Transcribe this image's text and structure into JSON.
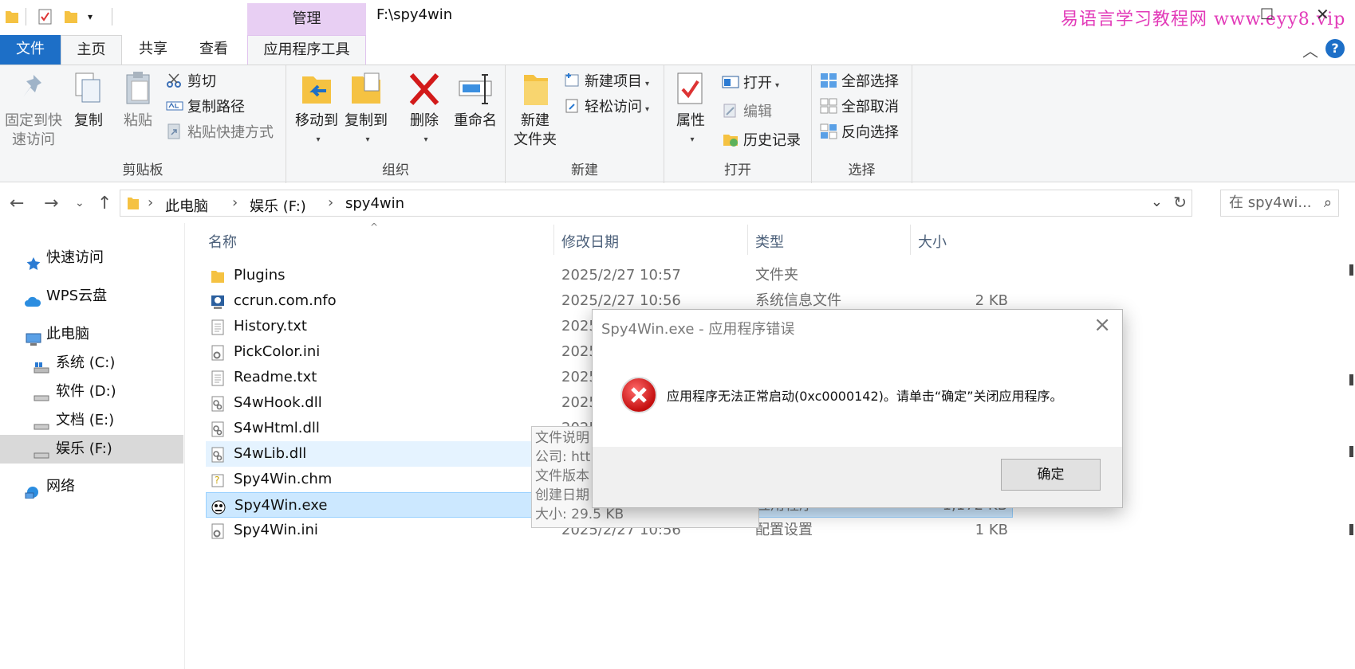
{
  "titlebar": {
    "manage_tab": "管理",
    "path": "F:\\spy4win",
    "watermark": "易语言学习教程网 www.eyy8.vip",
    "maximize": "□",
    "close": "✕"
  },
  "tabs": {
    "file": "文件",
    "home": "主页",
    "share": "共享",
    "view": "查看",
    "app_tools": "应用程序工具"
  },
  "ribbon": {
    "clipboard": {
      "label": "剪贴板",
      "pin_label": "固定到快速访问",
      "copy_label": "复制",
      "paste_label": "粘贴",
      "cut_label": "剪切",
      "copy_path_label": "复制路径",
      "paste_shortcut_label": "粘贴快捷方式"
    },
    "organize": {
      "label": "组织",
      "move_to_label": "移动到",
      "copy_to_label": "复制到",
      "delete_label": "删除",
      "rename_label": "重命名"
    },
    "new": {
      "label": "新建",
      "new_folder_label": "新建\n文件夹",
      "new_item_label": "新建项目",
      "easy_access_label": "轻松访问"
    },
    "open": {
      "label": "打开",
      "properties_label": "属性",
      "open_label": "打开",
      "edit_label": "编辑",
      "history_label": "历史记录"
    },
    "select": {
      "label": "选择",
      "select_all_label": "全部选择",
      "select_none_label": "全部取消",
      "invert_label": "反向选择"
    }
  },
  "address": {
    "crumbs": [
      "此电脑",
      "娱乐 (F:)",
      "spy4win"
    ],
    "search_placeholder": "在 spy4wi..."
  },
  "navpane": {
    "items": [
      {
        "label": "快速访问",
        "icon": "star-icon"
      },
      {
        "label": "WPS云盘",
        "icon": "cloud-icon"
      },
      {
        "label": "此电脑",
        "icon": "computer-icon"
      },
      {
        "label": "系统 (C:)",
        "icon": "windows-drive-icon"
      },
      {
        "label": "软件 (D:)",
        "icon": "drive-icon"
      },
      {
        "label": "文档 (E:)",
        "icon": "drive-icon"
      },
      {
        "label": "娱乐 (F:)",
        "icon": "drive-icon"
      },
      {
        "label": "网络",
        "icon": "network-icon"
      }
    ]
  },
  "filelist": {
    "columns": [
      "名称",
      "修改日期",
      "类型",
      "大小"
    ],
    "rows": [
      {
        "name": "Plugins",
        "date": "2025/2/27 10:57",
        "type": "文件夹",
        "size": "",
        "icon": "folder-icon"
      },
      {
        "name": "ccrun.com.nfo",
        "date": "2025/2/27 10:56",
        "type": "系统信息文件",
        "size": "2 KB",
        "icon": "system-info-icon"
      },
      {
        "name": "History.txt",
        "date": "2025",
        "type": "",
        "size": "",
        "icon": "text-file-icon"
      },
      {
        "name": "PickColor.ini",
        "date": "2025",
        "type": "",
        "size": "",
        "icon": "settings-file-icon"
      },
      {
        "name": "Readme.txt",
        "date": "2025",
        "type": "",
        "size": "",
        "icon": "text-file-icon"
      },
      {
        "name": "S4wHook.dll",
        "date": "2025",
        "type": "",
        "size": "",
        "icon": "dll-file-icon"
      },
      {
        "name": "S4wHtml.dll",
        "date": "2025",
        "type": "",
        "size": "",
        "icon": "dll-file-icon"
      },
      {
        "name": "S4wLib.dll",
        "date": "",
        "type": "",
        "size": "",
        "icon": "dll-file-icon"
      },
      {
        "name": "Spy4Win.chm",
        "date": "",
        "type": "",
        "size": "",
        "icon": "help-file-icon"
      },
      {
        "name": "Spy4Win.exe",
        "date": "",
        "type": "应用程序",
        "size": "1,172 KB",
        "icon": "spy-exe-icon"
      },
      {
        "name": "Spy4Win.ini",
        "date": "2025/2/27 10:56",
        "type": "配置设置",
        "size": "1 KB",
        "icon": "settings-file-icon"
      }
    ]
  },
  "tooltip": {
    "lines": [
      "文件说明",
      "公司: htt",
      "文件版本",
      "创建日期",
      "大小: 29.5 KB"
    ]
  },
  "dialog": {
    "title": "Spy4Win.exe - 应用程序错误",
    "message": "应用程序无法正常启动(0xc0000142)。请单击“确定”关闭应用程序。",
    "ok_label": "确定"
  }
}
